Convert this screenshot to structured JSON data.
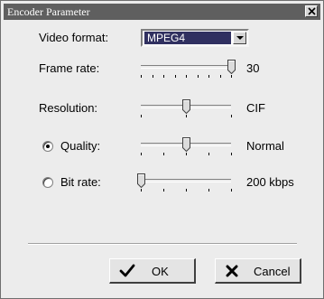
{
  "window": {
    "title": "Encoder Parameter"
  },
  "video_format": {
    "label": "Video format:",
    "selected": "MPEG4"
  },
  "frame_rate": {
    "label": "Frame rate:",
    "value": "30",
    "level": 1.0
  },
  "resolution": {
    "label": "Resolution:",
    "value": "CIF",
    "level": 0.5
  },
  "quality": {
    "label": "Quality:",
    "value": "Normal",
    "level": 0.5,
    "selected": true
  },
  "bit_rate": {
    "label": "Bit rate:",
    "value": "200 kbps",
    "level": 0.0,
    "selected": false
  },
  "buttons": {
    "ok": "OK",
    "cancel": "Cancel"
  }
}
